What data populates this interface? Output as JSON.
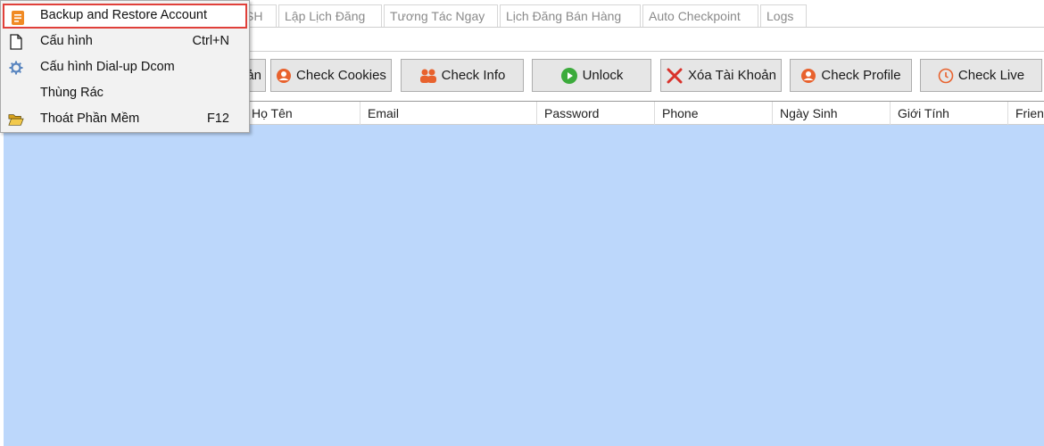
{
  "tabs": [
    {
      "label": "SH"
    },
    {
      "label": "Lập Lịch Đăng"
    },
    {
      "label": "Tương Tác Ngay"
    },
    {
      "label": "Lịch Đăng Bán Hàng"
    },
    {
      "label": "Auto Checkpoint"
    },
    {
      "label": "Logs"
    }
  ],
  "toolbar": {
    "partial_label": "ản",
    "check_cookies": "Check Cookies",
    "check_info": "Check Info",
    "unlock": "Unlock",
    "xoa_tai_khoan": "Xóa Tài Khoản",
    "check_profile": "Check Profile",
    "check_live": "Check Live"
  },
  "grid": {
    "columns": [
      "Họ Tên",
      "Email",
      "Password",
      "Phone",
      "Ngày Sinh",
      "Giới Tính",
      "Frien"
    ]
  },
  "menu": {
    "items": [
      {
        "label": "Backup and Restore Account",
        "shortcut": "",
        "icon": "backup-icon"
      },
      {
        "label": "Cấu hình",
        "shortcut": "Ctrl+N",
        "icon": "new-file-icon"
      },
      {
        "label": "Cấu hình Dial-up Dcom",
        "shortcut": "",
        "icon": "gear-icon"
      },
      {
        "label": "Thùng Rác",
        "shortcut": "",
        "icon": ""
      },
      {
        "label": "Thoát Phần Mềm",
        "shortcut": "F12",
        "icon": "open-folder-icon"
      }
    ]
  },
  "colors": {
    "grid_body": "#bcd7fb",
    "menu_highlight_border": "#e0403a",
    "unlock_green": "#3cab3c",
    "icon_orange": "#e8622e"
  }
}
